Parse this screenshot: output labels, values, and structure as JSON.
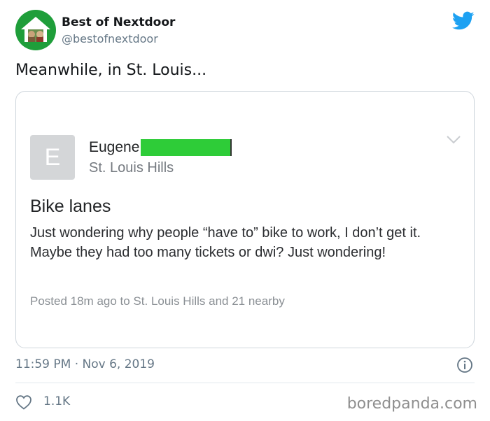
{
  "account": {
    "display_name": "Best of Nextdoor",
    "handle": "@bestofnextdoor",
    "avatar_icon": "nextdoor-house-logo"
  },
  "tweet": {
    "text": "Meanwhile, in St. Louis..."
  },
  "post": {
    "avatar_letter": "E",
    "author_name": "Eugene",
    "location": "St. Louis Hills",
    "title": "Bike lanes",
    "body": "Just wondering why people “have to” bike to work, I don’t get it.  Maybe they had too many tickets or dwi? Just wondering!",
    "meta": "Posted 18m ago to St. Louis Hills and 21 nearby",
    "redaction_color": "#2ecc38"
  },
  "footer": {
    "timestamp": "11:59 PM · Nov 6, 2019",
    "likes": "1.1K"
  },
  "watermark": "boredpanda.com",
  "colors": {
    "twitter_blue": "#1da1f2",
    "secondary_text": "#657786",
    "nextdoor_green": "#1f9e3a"
  }
}
